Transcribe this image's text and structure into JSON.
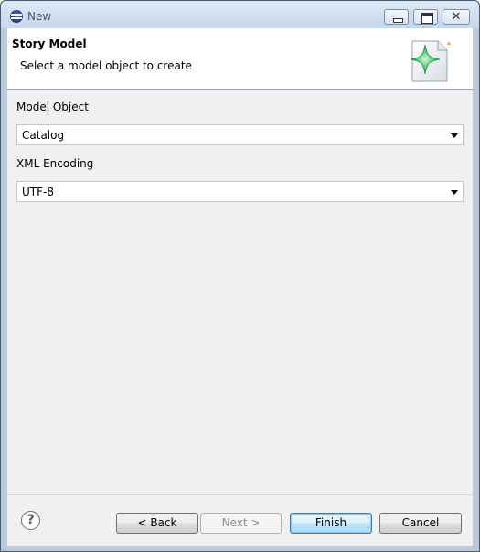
{
  "window": {
    "title": "New",
    "minimize_symbol": "",
    "maximize_symbol": "",
    "close_symbol": "✕"
  },
  "header": {
    "title": "Story Model",
    "description": "Select a model object to create"
  },
  "form": {
    "model_object_label": "Model Object",
    "model_object_value": "Catalog",
    "xml_encoding_label": "XML Encoding",
    "xml_encoding_value": "UTF-8"
  },
  "buttons": {
    "help": "?",
    "back": "< Back",
    "next": "Next >",
    "finish": "Finish",
    "cancel": "Cancel"
  },
  "colors": {
    "accent": "#3c7fb1",
    "wizard_star": "#3fb86a"
  }
}
